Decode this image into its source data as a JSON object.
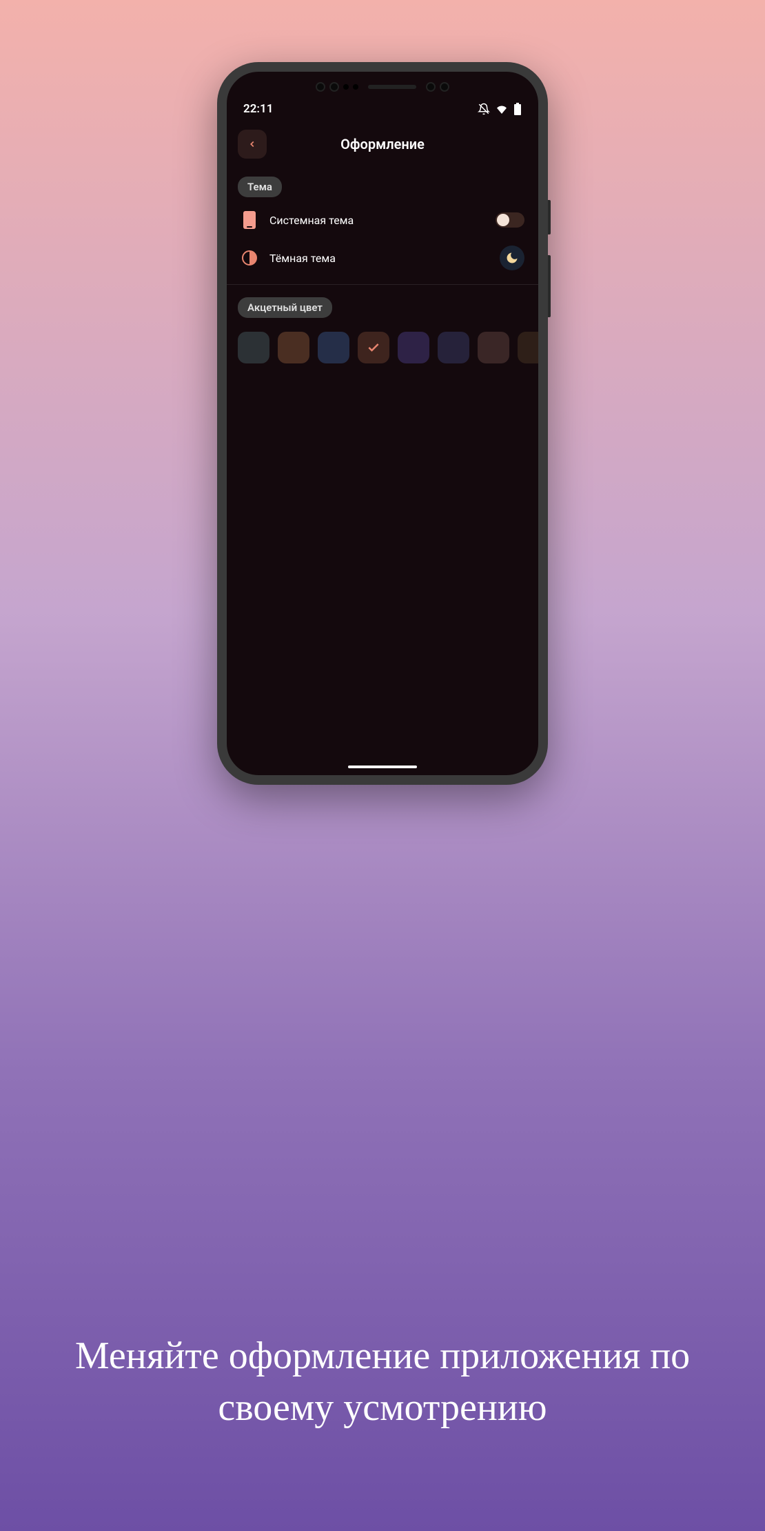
{
  "statusbar": {
    "time": "22:11"
  },
  "header": {
    "title": "Оформление"
  },
  "sections": {
    "theme": {
      "label": "Тема",
      "rows": {
        "system": {
          "label": "Системная тема"
        },
        "dark": {
          "label": "Тёмная тема"
        }
      }
    },
    "accent": {
      "label": "Акцетный цвет",
      "colors": [
        {
          "hex": "#2c3135",
          "selected": false
        },
        {
          "hex": "#4a2e22",
          "selected": false
        },
        {
          "hex": "#252e48",
          "selected": false
        },
        {
          "hex": "#3e241e",
          "selected": true
        },
        {
          "hex": "#2e2246",
          "selected": false
        },
        {
          "hex": "#26223a",
          "selected": false
        },
        {
          "hex": "#3a2626",
          "selected": false
        },
        {
          "hex": "#2e1f18",
          "selected": false
        }
      ]
    }
  },
  "caption": {
    "text": "Меняйте оформление приложения по своему усмотрению"
  },
  "accent_check_color": "#e8856f"
}
